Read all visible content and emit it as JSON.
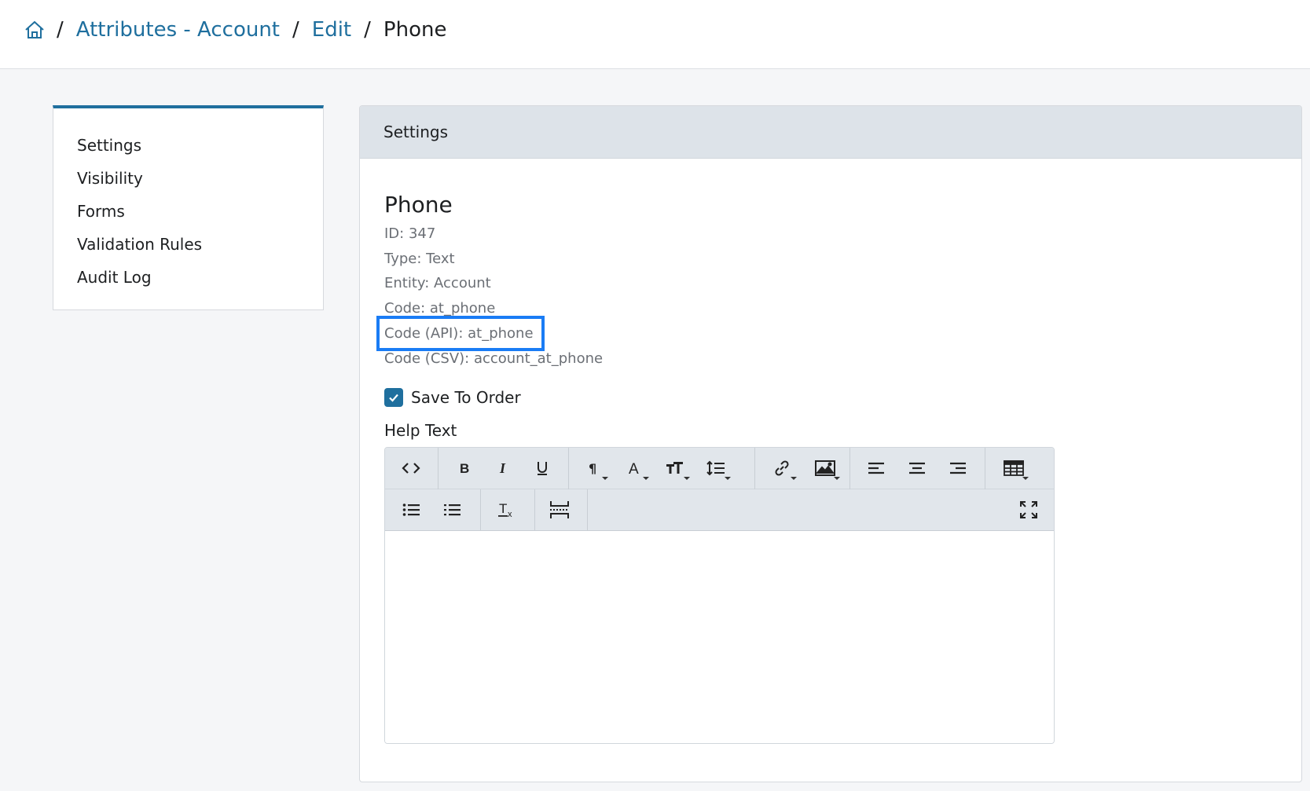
{
  "breadcrumb": {
    "home_icon": "home-icon",
    "items": [
      "Attributes - Account",
      "Edit"
    ],
    "current": "Phone",
    "separator": "/"
  },
  "sidenav": {
    "items": [
      "Settings",
      "Visibility",
      "Forms",
      "Validation Rules",
      "Audit Log"
    ]
  },
  "panel": {
    "header": "Settings",
    "title": "Phone",
    "meta": {
      "id": "ID: 347",
      "type": "Type: Text",
      "entity": "Entity: Account",
      "code": "Code: at_phone",
      "code_api": "Code (API): at_phone",
      "code_csv": "Code (CSV): account_at_phone"
    },
    "save_to_order": {
      "label": "Save To Order",
      "checked": true
    },
    "help_text_label": "Help Text"
  },
  "editor": {
    "toolbar_row1": [
      "code-view",
      "bold",
      "italic",
      "underline",
      "paragraph",
      "font-color",
      "font-size",
      "line-height",
      "link",
      "image",
      "align-left",
      "align-center",
      "align-right",
      "table"
    ],
    "toolbar_row2": [
      "bullet-list",
      "ordered-list",
      "clear-format",
      "horizontal-rule",
      "fullscreen"
    ],
    "content": ""
  },
  "colors": {
    "accent": "#1f6f9e",
    "highlight": "#1a7cf5",
    "header_bg": "#dde3e9",
    "page_bg": "#f5f6f8"
  }
}
